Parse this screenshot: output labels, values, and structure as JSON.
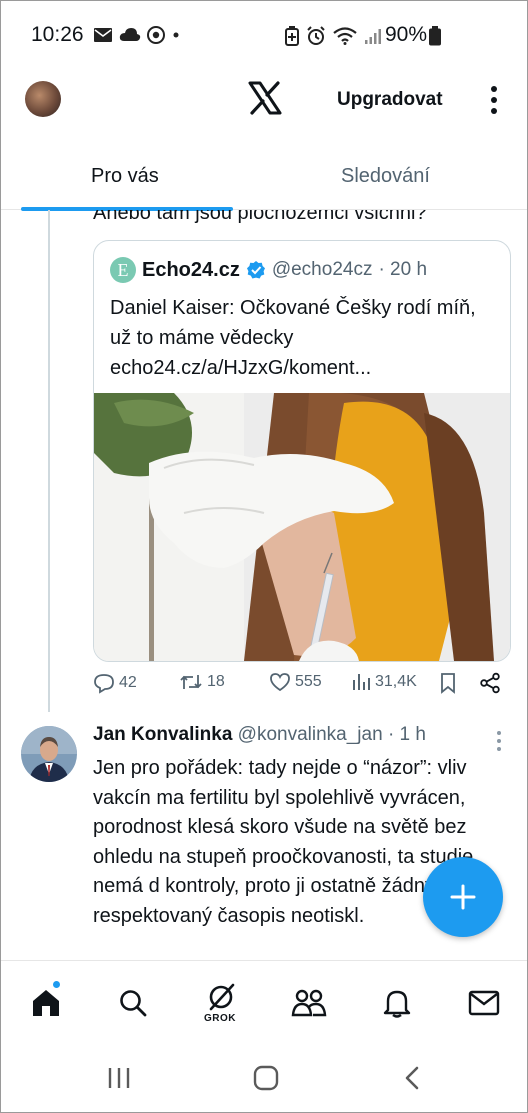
{
  "status_bar": {
    "time": "10:26",
    "battery": "90%"
  },
  "header": {
    "upgrade_label": "Upgradovat"
  },
  "tabs": [
    {
      "label": "Pro vás"
    },
    {
      "label": "Sledování"
    }
  ],
  "previous_post": {
    "text_tail": "Anebo tam jsou plochozemci všichni?"
  },
  "quoted": {
    "name": "Echo24.cz",
    "handle": "@echo24cz",
    "time": "· 20 h",
    "text": "Daniel Kaiser: Očkované Češky rodí míň, už to máme vědecky echo24.cz/a/HJzxG/koment..."
  },
  "actions": {
    "replies": "42",
    "reposts": "18",
    "likes": "555",
    "views": "31,4K"
  },
  "post": {
    "name": "Jan Konvalinka",
    "handle": "@konvalinka_jan",
    "time": "· 1 h",
    "text": "Jen pro pořádek: tady nejde o “názor”: vliv vakcín ma fertilitu byl spolehlivě vyvrácen, porodnost klesá skoro všude na světě bez ohledu na stupeň proočkovanosti, ta studie nemá d kontroly, proto ji ostatně žádný respektovaný časopis neotiskl."
  },
  "bottom_nav": {
    "grok_label": "GROK"
  },
  "colors": {
    "accent": "#1d9bf0",
    "text": "#0f1419",
    "muted": "#536471"
  },
  "icons": [
    "mail-icon",
    "cloud-icon",
    "chrome-icon",
    "battery-saver-icon",
    "alarm-icon",
    "wifi-icon",
    "signal-icon",
    "x-logo",
    "kebab-icon",
    "verified-icon",
    "reply-icon",
    "repost-icon",
    "like-icon",
    "views-icon",
    "bookmark-icon",
    "share-icon",
    "plus-icon",
    "home-icon",
    "search-icon",
    "grok-icon",
    "people-icon",
    "bell-icon",
    "messages-icon"
  ]
}
